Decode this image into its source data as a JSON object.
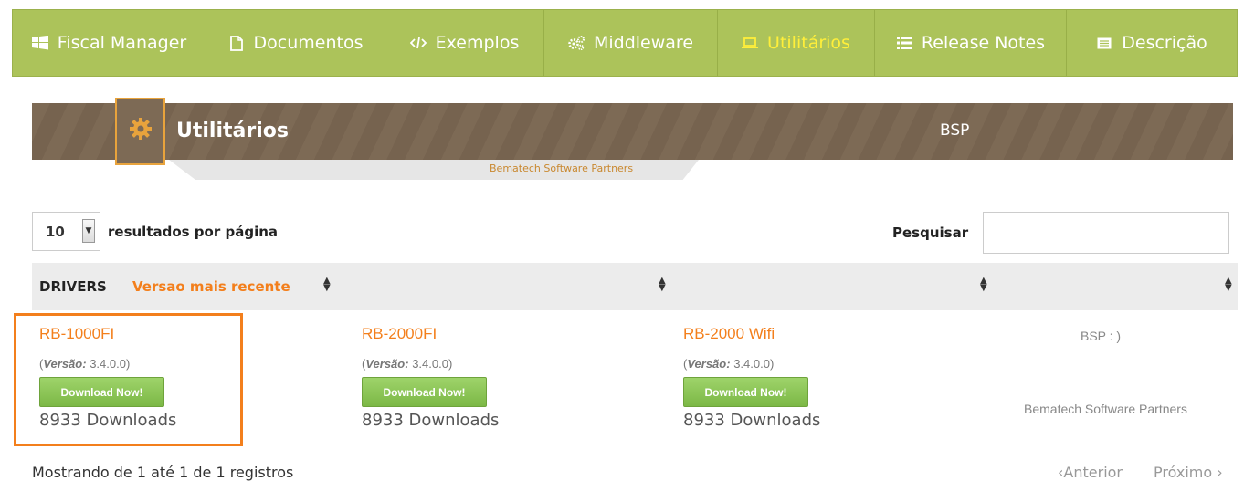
{
  "nav": [
    {
      "label": "Fiscal Manager",
      "icon": "windows-icon"
    },
    {
      "label": "Documentos",
      "icon": "document-icon"
    },
    {
      "label": "Exemplos",
      "icon": "code-icon"
    },
    {
      "label": "Middleware",
      "icon": "cogs-icon"
    },
    {
      "label": "Utilitários",
      "icon": "laptop-icon",
      "active": true
    },
    {
      "label": "Release Notes",
      "icon": "list-icon"
    },
    {
      "label": "Descrição",
      "icon": "card-icon"
    }
  ],
  "banner": {
    "title": "Utilitários",
    "subtitle": "Bematech Software Partners",
    "right_label": "BSP"
  },
  "controls": {
    "page_length": "10",
    "page_length_label": "resultados por página",
    "search_label": "Pesquisar",
    "search_value": ""
  },
  "table": {
    "header_drivers": "DRIVERS",
    "header_recent": "Versao mais recente",
    "products": [
      {
        "name": "RB-1000FI",
        "version_label": "Versão:",
        "version": "3.4.0.0",
        "button": "Download Now!",
        "downloads": "8933 Downloads"
      },
      {
        "name": "RB-2000FI",
        "version_label": "Versão:",
        "version": "3.4.0.0",
        "button": "Download Now!",
        "downloads": "8933 Downloads"
      },
      {
        "name": "RB-2000 Wifi",
        "version_label": "Versão:",
        "version": "3.4.0.0",
        "button": "Download Now!",
        "downloads": "8933 Downloads"
      }
    ],
    "col4_title": "BSP : )",
    "col4_subtitle": "Bematech Software Partners"
  },
  "footer": {
    "info": "Mostrando de 1 até 1 de 1 registros",
    "prev": "Anterior",
    "next": "Próximo"
  },
  "colors": {
    "nav_bg": "#acc35a",
    "nav_active": "#ffef3a",
    "accent_orange": "#f37f1c",
    "banner_bg": "#7d6a55",
    "button_green": "#8cc456"
  }
}
